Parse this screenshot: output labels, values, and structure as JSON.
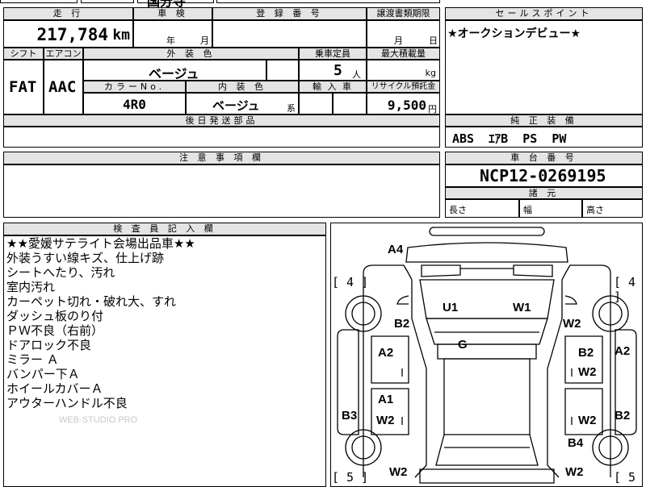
{
  "top_cut": {
    "partial_text": "国分寺"
  },
  "odometer": {
    "header": "走 行",
    "value": "217,784",
    "unit": "km"
  },
  "inspection": {
    "header": "車 検",
    "month_label": "月",
    "year_label": "年"
  },
  "registration": {
    "header": "登 録 番 号"
  },
  "transfer_deadline": {
    "header": "譲渡書類期限",
    "month_label": "月",
    "day_label": "日"
  },
  "sales_point": {
    "header": "セールスポイント",
    "text": "★オークションデビュー★"
  },
  "shift": {
    "header": "シフト",
    "value": "FAT"
  },
  "aircon": {
    "header": "エアコン",
    "value": "AAC"
  },
  "exterior_color": {
    "header": "外 装 色",
    "value": "ベージュ"
  },
  "capacity": {
    "header": "乗車定員",
    "value": "5",
    "unit": "人"
  },
  "max_load": {
    "header": "最大積載量",
    "unit": "kg"
  },
  "color_no": {
    "header": "カラーNo.",
    "value": "4R0"
  },
  "interior_color": {
    "header": "内 装 色",
    "value": "ベージュ",
    "suffix": "系"
  },
  "import_car": {
    "header": "輸 入 車"
  },
  "recycle": {
    "header": "リサイクル預託金",
    "value": "9,500",
    "unit": "円"
  },
  "later_parts": {
    "header": "後日発送部品"
  },
  "genuine_equipment": {
    "header": "純 正 装 備",
    "value": "ABS  ｴｱB  PS  PW"
  },
  "caution": {
    "header": "注 意 事 項 欄"
  },
  "chassis": {
    "header": "車 台 番 号",
    "value": "NCP12-0269195"
  },
  "specs": {
    "header": "諸 元",
    "length_label": "長さ",
    "width_label": "幅",
    "height_label": "高さ"
  },
  "inspector": {
    "header": "検 査 員 記 入 欄",
    "lines": [
      "★★愛媛サテライト会場出品車★★",
      "外装うすい線キズ、仕上げ跡",
      "シートへたり、汚れ",
      "室内汚れ",
      "カーペット切れ・破れ大、すれ",
      "ダッシュ板のり付",
      "ＰＷ不良（右前）",
      "ドアロック不良",
      "ミラー Ａ",
      "バンパー下Ａ",
      "ホイールカバーＡ",
      "アウターハンドル不良"
    ],
    "watermark": "WEB-STUDIO.PRO"
  },
  "damage_map": {
    "tire_left_top": "[ 4 ]",
    "tire_right_top": "[ 4 ]",
    "tire_left_bottom": "[ 5 ]",
    "tire_right_bottom": "[ 5",
    "marks": {
      "a4": "A4",
      "u1": "U1",
      "w1": "W1",
      "b2_left": "B2",
      "w2_right_top": "W2",
      "g": "G",
      "a2_left": "A2",
      "b2_right": "B2",
      "a2_far_right": "A2",
      "w2_right_mid": "W2",
      "a1": "A1",
      "w2_left": "W2",
      "b3": "B3",
      "w2_right_low": "W2",
      "b2_far_right": "B2",
      "b4": "B4",
      "w2_bottom_left": "W2",
      "w2_bottom_right": "W2"
    }
  }
}
